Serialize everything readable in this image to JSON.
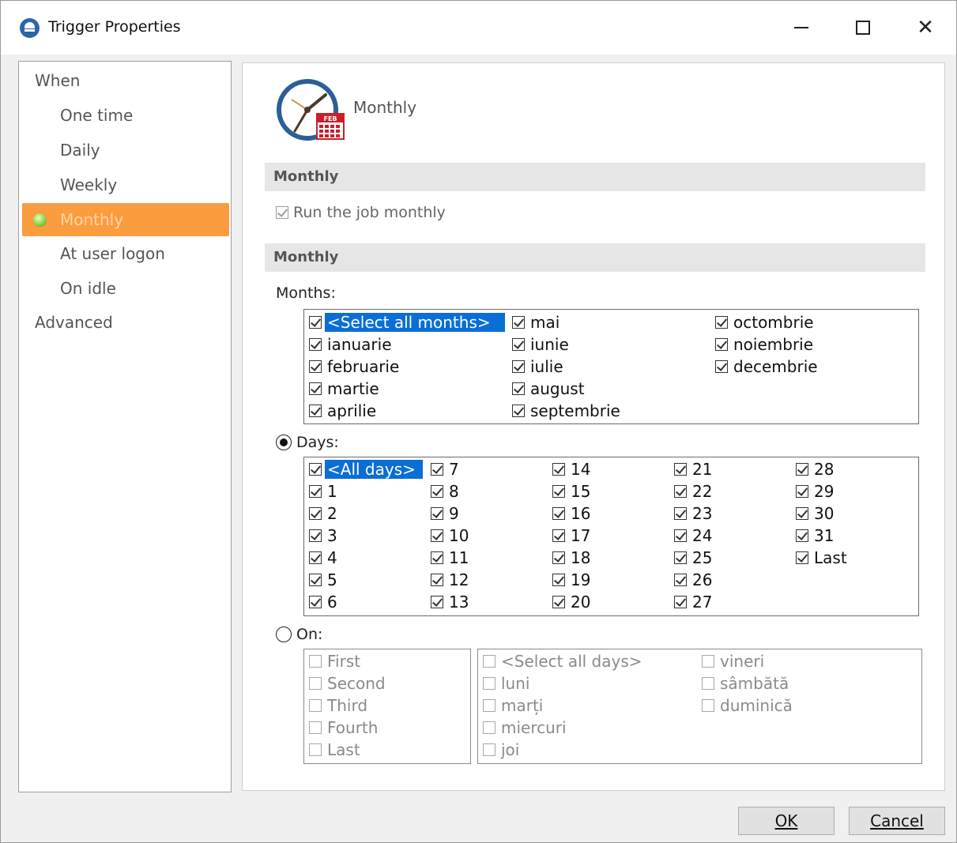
{
  "window": {
    "title": "Trigger Properties"
  },
  "sidebar": {
    "group_when": "When",
    "items": [
      "One time",
      "Daily",
      "Weekly",
      "Monthly",
      "At user logon",
      "On idle"
    ],
    "selected": "Monthly",
    "group_advanced": "Advanced"
  },
  "header": {
    "title": "Monthly"
  },
  "section1": {
    "title": "Monthly",
    "run_label": "Run the job monthly",
    "run_checked": true
  },
  "section2": {
    "title": "Monthly",
    "months_label": "Months:",
    "months": [
      [
        "<Select all months>",
        "ianuarie",
        "februarie",
        "martie",
        "aprilie"
      ],
      [
        "mai",
        "iunie",
        "iulie",
        "august",
        "septembrie"
      ],
      [
        "octombrie",
        "noiembrie",
        "decembrie"
      ]
    ],
    "days_label": "Days:",
    "days_selected": true,
    "days": [
      [
        "<All days>",
        "1",
        "2",
        "3",
        "4",
        "5",
        "6"
      ],
      [
        "7",
        "8",
        "9",
        "10",
        "11",
        "12",
        "13"
      ],
      [
        "14",
        "15",
        "16",
        "17",
        "18",
        "19",
        "20"
      ],
      [
        "21",
        "22",
        "23",
        "24",
        "25",
        "26",
        "27"
      ],
      [
        "28",
        "29",
        "30",
        "31",
        "Last"
      ]
    ],
    "on_label": "On:",
    "on_selected": false,
    "ordinals": [
      "First",
      "Second",
      "Third",
      "Fourth",
      "Last"
    ],
    "weekdays": [
      [
        "<Select all days>",
        "luni",
        "marți",
        "miercuri",
        "joi"
      ],
      [
        "vineri",
        "sâmbătă",
        "duminică"
      ]
    ]
  },
  "buttons": {
    "ok": "OK",
    "cancel": "Cancel"
  },
  "colors": {
    "accent_selected_nav": "#fb9c3e",
    "list_selection": "#0a6ed6",
    "section_bar": "#e6e6e6"
  }
}
